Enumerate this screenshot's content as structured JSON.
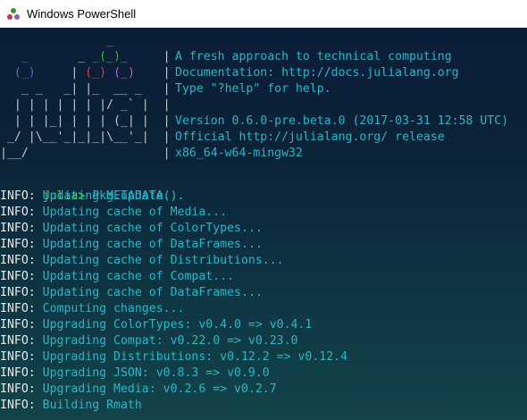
{
  "window": {
    "title": "Windows PowerShell"
  },
  "logo_rows": [
    {
      "text": "               _"
    },
    {
      "text": "   _       _ _(_)_     |"
    },
    {
      "text": "  (_)     | (_) (_)    |"
    },
    {
      "text": "   _ _   _| |_  __ _   |"
    },
    {
      "text": "  | | | | | | |/ _` |  |"
    },
    {
      "text": "  | | |_| | | | (_| |  |"
    },
    {
      "text": " _/ |\\__'_|_|_|\\__'_|  |"
    },
    {
      "text": "|__/                   |"
    }
  ],
  "banner": [
    "A fresh approach to technical computing",
    "Documentation: http://docs.julialang.org",
    "Type \"?help\" for help.",
    "",
    "Version 0.6.0-pre.beta.0 (2017-03-31 12:58 UTC)",
    "Official http://julialang.org/ release",
    "x86_64-w64-mingw32"
  ],
  "prompt": {
    "label": "julia>",
    "command": "Pkg.update()"
  },
  "info_label": "INFO:",
  "info_lines": [
    "Updating METADATA...",
    "Updating cache of Media...",
    "Updating cache of ColorTypes...",
    "Updating cache of DataFrames...",
    "Updating cache of Distributions...",
    "Updating cache of Compat...",
    "Updating cache of DataFrames...",
    "Computing changes...",
    "Upgrading ColorTypes: v0.4.0 => v0.4.1",
    "Upgrading Compat: v0.22.0 => v0.23.0",
    "Upgrading Distributions: v0.12.2 => v0.12.4",
    "Upgrading JSON: v0.8.3 => v0.9.0",
    "Upgrading Media: v0.2.6 => v0.2.7",
    "Building Rmath"
  ]
}
